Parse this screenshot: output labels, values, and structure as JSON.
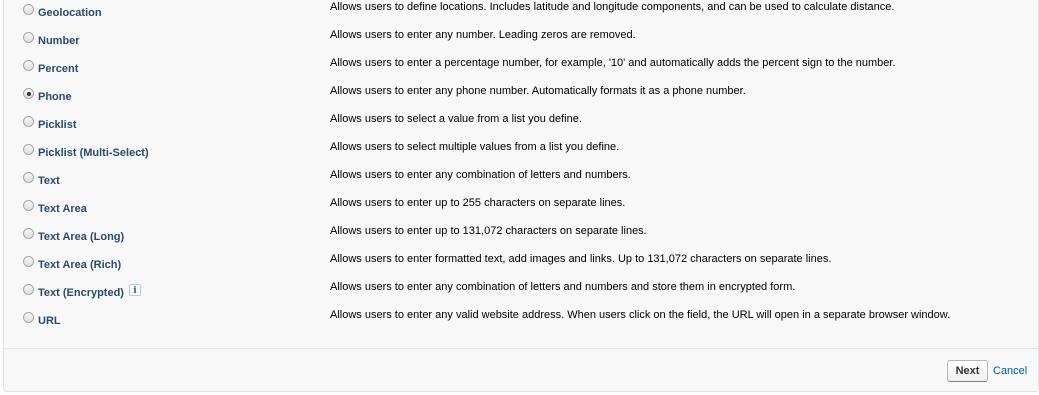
{
  "field_types": [
    {
      "label": "Geolocation",
      "description": "Allows users to define locations. Includes latitude and longitude components, and can be used to calculate distance.",
      "selected": false
    },
    {
      "label": "Number",
      "description": "Allows users to enter any number. Leading zeros are removed.",
      "selected": false
    },
    {
      "label": "Percent",
      "description": "Allows users to enter a percentage number, for example, '10' and automatically adds the percent sign to the number.",
      "selected": false
    },
    {
      "label": "Phone",
      "description": "Allows users to enter any phone number. Automatically formats it as a phone number.",
      "selected": true
    },
    {
      "label": "Picklist",
      "description": "Allows users to select a value from a list you define.",
      "selected": false
    },
    {
      "label": "Picklist (Multi-Select)",
      "description": "Allows users to select multiple values from a list you define.",
      "selected": false
    },
    {
      "label": "Text",
      "description": "Allows users to enter any combination of letters and numbers.",
      "selected": false
    },
    {
      "label": "Text Area",
      "description": "Allows users to enter up to 255 characters on separate lines.",
      "selected": false
    },
    {
      "label": "Text Area (Long)",
      "description": "Allows users to enter up to 131,072 characters on separate lines.",
      "selected": false
    },
    {
      "label": "Text Area (Rich)",
      "description": "Allows users to enter formatted text, add images and links. Up to 131,072 characters on separate lines.",
      "selected": false
    },
    {
      "label": "Text (Encrypted)",
      "description": "Allows users to enter any combination of letters and numbers and store them in encrypted form.",
      "selected": false,
      "info_icon": "i"
    },
    {
      "label": "URL",
      "description": "Allows users to enter any valid website address. When users click on the field, the URL will open in a separate browser window.",
      "selected": false
    }
  ],
  "buttons": {
    "next_label": "Next",
    "cancel_label": "Cancel"
  },
  "colors": {
    "label": "#2b4a6e",
    "link": "#015ba7",
    "panel_bg": "#f8f8f8"
  }
}
